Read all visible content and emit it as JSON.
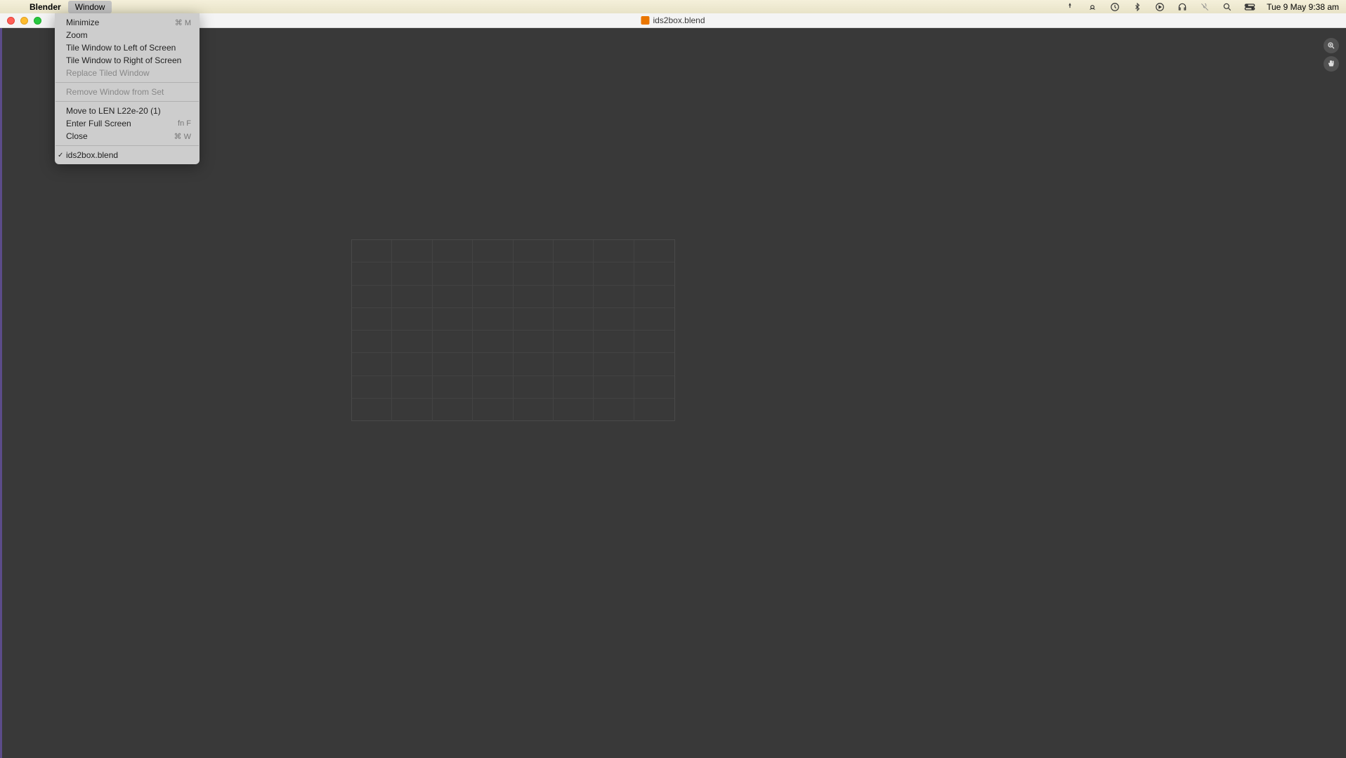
{
  "menubar": {
    "app_name": "Blender",
    "window_menu": "Window",
    "date_time": "Tue 9 May  9:38 am"
  },
  "titlebar": {
    "filename": "ids2box.blend"
  },
  "dropdown": {
    "minimize": "Minimize",
    "minimize_sc": "⌘ M",
    "zoom": "Zoom",
    "tile_left": "Tile Window to Left of Screen",
    "tile_right": "Tile Window to Right of Screen",
    "replace_tiled": "Replace Tiled Window",
    "remove_set": "Remove Window from Set",
    "move_to": "Move to LEN L22e-20 (1)",
    "fullscreen": "Enter Full Screen",
    "fullscreen_sc": "fn F",
    "close": "Close",
    "close_sc": "⌘ W",
    "open_window": "ids2box.blend"
  }
}
